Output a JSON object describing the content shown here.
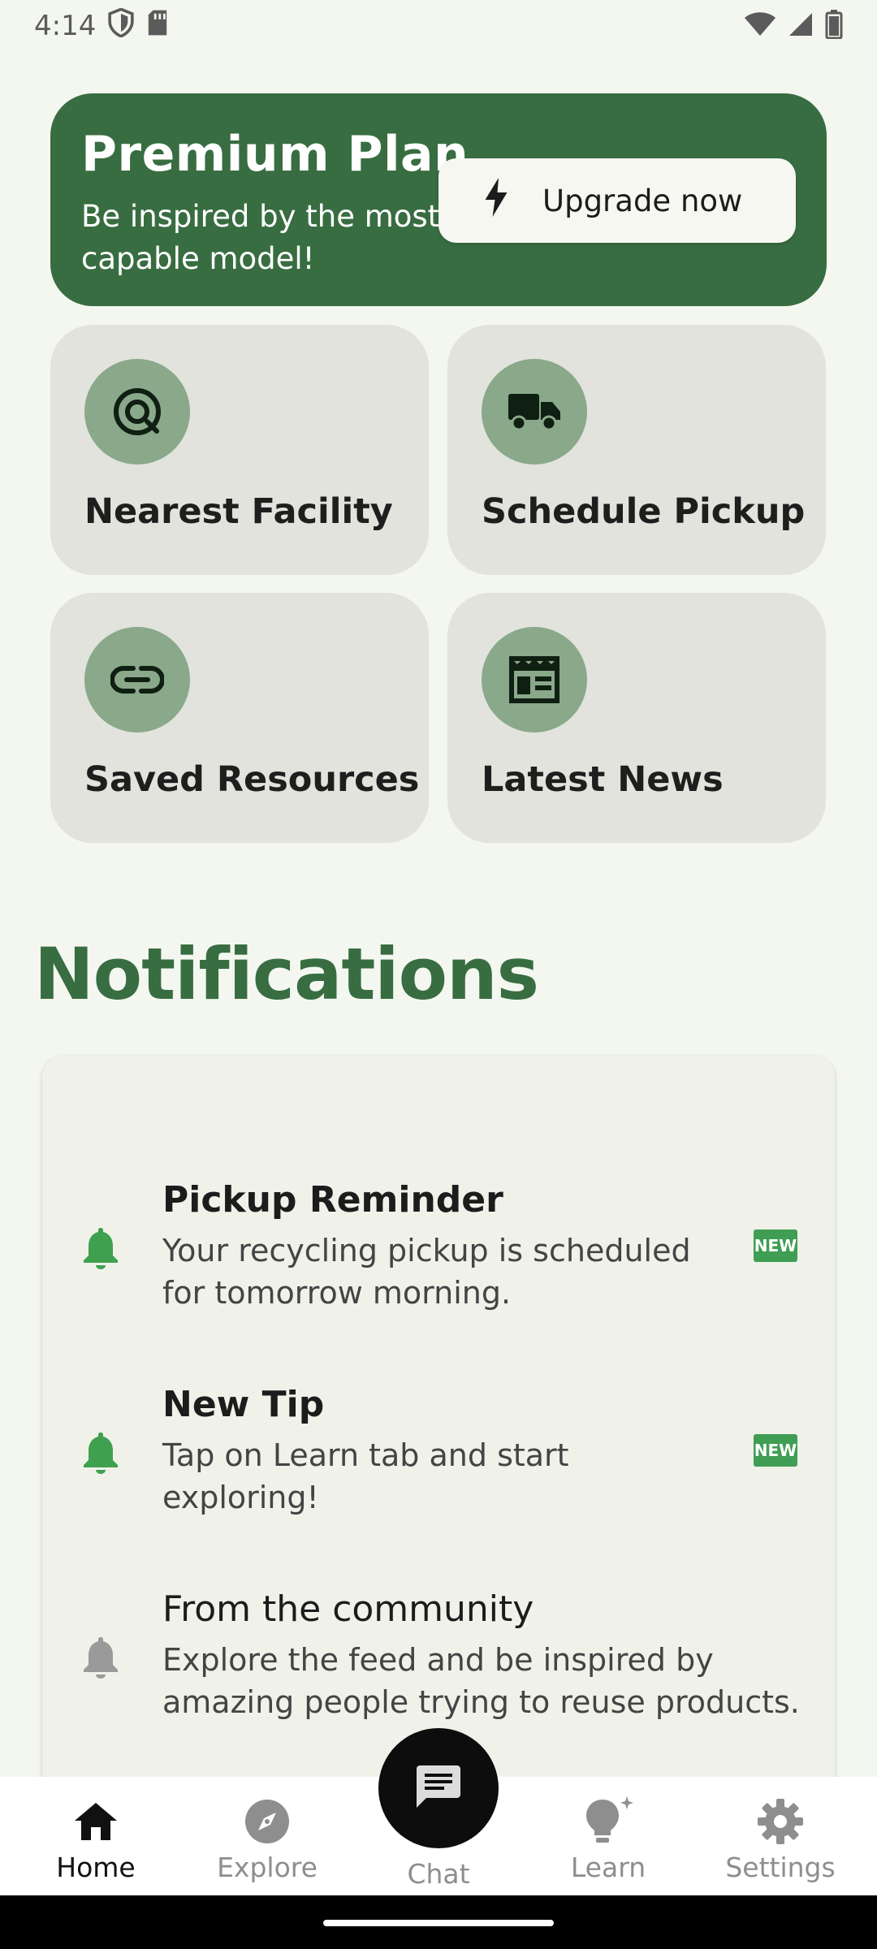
{
  "status_bar": {
    "time": "4:14",
    "icons": [
      "shield-icon",
      "sim-card-icon",
      "wifi-icon",
      "signal-icon",
      "battery-icon"
    ]
  },
  "premium": {
    "title": "Premium Plan",
    "subtitle": "Be inspired by the most-capable model!",
    "button_label": "Upgrade now",
    "button_icon": "bolt-icon",
    "bg_color": "#386d41"
  },
  "tiles": [
    {
      "label": "Nearest Facility",
      "icon": "location-target-icon"
    },
    {
      "label": "Schedule Pickup",
      "icon": "truck-icon"
    },
    {
      "label": "Saved Resources",
      "icon": "link-icon"
    },
    {
      "label": "Latest News",
      "icon": "newspaper-icon"
    }
  ],
  "notifications": {
    "heading": "Notifications",
    "items": [
      {
        "title": "Pickup Reminder",
        "body": "Your recycling pickup is scheduled for tomorrow morning.",
        "is_new": true,
        "badge": "NEW",
        "bell_color": "#3fa04f"
      },
      {
        "title": "New Tip",
        "body": "Tap on Learn tab and start exploring!",
        "is_new": true,
        "badge": "NEW",
        "bell_color": "#3fa04f"
      },
      {
        "title": "From the community",
        "body": "Explore the feed and be inspired by amazing people trying to reuse products.",
        "is_new": false,
        "bell_color": "#9a9a9a"
      }
    ]
  },
  "bottom_nav": {
    "items": [
      {
        "label": "Home",
        "icon": "home-icon",
        "active": true
      },
      {
        "label": "Explore",
        "icon": "compass-icon",
        "active": false
      },
      {
        "label": "Chat",
        "icon": "chat-icon",
        "active": false
      },
      {
        "label": "Learn",
        "icon": "lightbulb-icon",
        "active": false
      },
      {
        "label": "Settings",
        "icon": "gear-icon",
        "active": false
      }
    ]
  }
}
